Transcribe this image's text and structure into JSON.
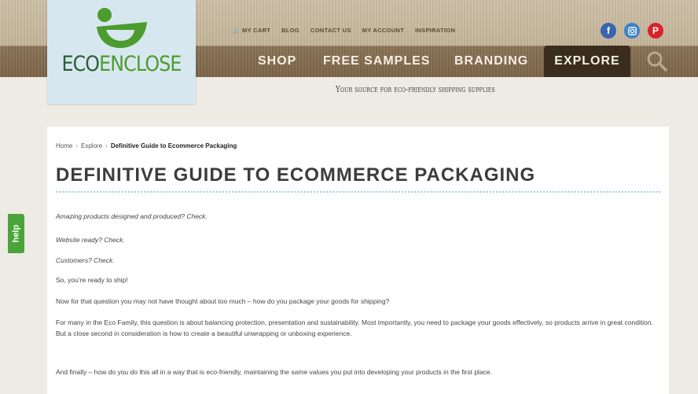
{
  "logo": {
    "text_main": "ECO",
    "text_accent": "ENCLOSE"
  },
  "utility_nav": {
    "cart_icon": "cart-icon",
    "items": [
      "MY CART",
      "BLOG",
      "CONTACT US",
      "MY ACCOUNT",
      "INSPIRATION"
    ]
  },
  "social": [
    {
      "name": "facebook-icon",
      "glyph": "f"
    },
    {
      "name": "instagram-icon",
      "glyph": "◙"
    },
    {
      "name": "pinterest-icon",
      "glyph": "P"
    }
  ],
  "main_nav": {
    "items": [
      "SHOP",
      "FREE SAMPLES",
      "BRANDING"
    ],
    "active": "EXPLORE"
  },
  "tagline": "Your source for eco-friendly shipping supplies",
  "breadcrumb": {
    "home": "Home",
    "sep": "›",
    "section": "Explore",
    "current": "Definitive Guide to Ecommerce Packaging"
  },
  "page": {
    "title": "DEFINITIVE GUIDE TO ECOMMERCE PACKAGING",
    "paragraphs": [
      "Amazing products designed and produced? Check.",
      "Website ready? Check.",
      "Customers? Check.",
      "So, you’re ready to ship!",
      "Now for that question you may not have thought about too much – how do you package your goods for shipping?",
      "For many in the Eco Family, this question is about balancing protection, presentation and sustainability. Most importantly, you need to package your goods effectively, so products arrive in great condition. But a close second in consideration is how to create a beautiful unwrapping or unboxing experience.",
      "And finally – how do you do this all in a way that is eco-friendly, maintaining the same values you put into developing your products in the first place."
    ]
  },
  "help_tab": {
    "label": "help"
  },
  "colors": {
    "brand_green": "#2a5f36",
    "accent_green": "#4c9c2e",
    "nav_brown": "#7b6548",
    "explore_dark": "#3a2d1d",
    "help_green": "#4aa43a"
  }
}
